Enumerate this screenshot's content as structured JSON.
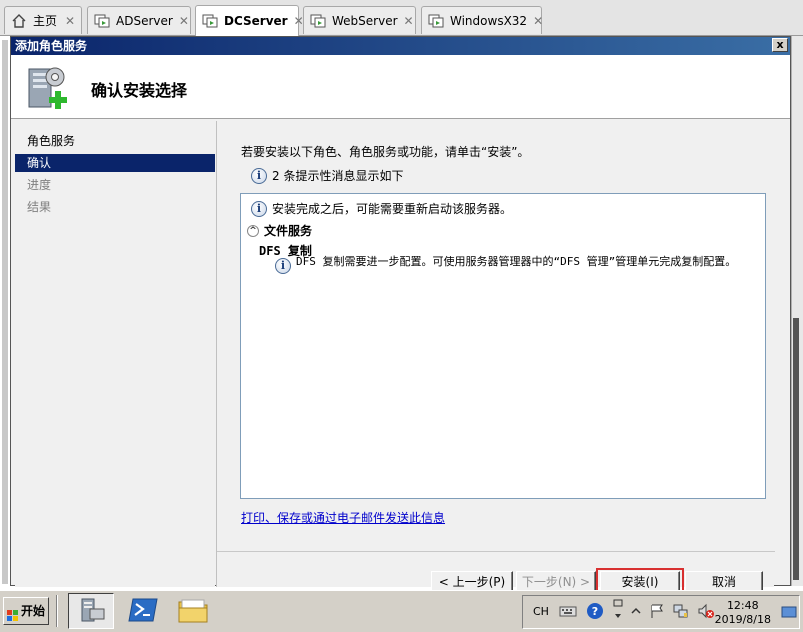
{
  "tabs": [
    {
      "label": "主页",
      "icon": "home-icon"
    },
    {
      "label": "ADServer",
      "icon": "vm-icon"
    },
    {
      "label": "DCServer",
      "icon": "vm-icon",
      "active": true
    },
    {
      "label": "WebServer",
      "icon": "vm-icon"
    },
    {
      "label": "WindowsX32",
      "icon": "vm-icon"
    }
  ],
  "dialog": {
    "title": "添加角色服务",
    "close_label": "x",
    "header_title": "确认安装选择",
    "nav": [
      "角色服务",
      "确认",
      "进度",
      "结果"
    ],
    "intro": "若要安装以下角色、角色服务或功能，请单击“安装”。",
    "note": "2 条提示性消息显示如下",
    "details": {
      "restart_msg": "安装完成之后，可能需要重新启动该服务器。",
      "section": "文件服务",
      "item": "DFS 复制",
      "item_msg": "DFS 复制需要进一步配置。可使用服务器管理器中的“DFS 管理”管理单元完成复制配置。"
    },
    "link": "打印、保存或通过电子邮件发送此信息",
    "buttons": {
      "prev": "< 上一步(P)",
      "next": "下一步(N) >",
      "install": "安装(I)",
      "cancel": "取消"
    }
  },
  "taskbar": {
    "start_label": "开始",
    "lang": "CH",
    "time": "12:48",
    "date": "2019/8/18"
  },
  "colors": {
    "title_bar": "#0a246a",
    "selection": "#0a246a",
    "highlight_border": "#d83030",
    "link": "#0000cc"
  }
}
